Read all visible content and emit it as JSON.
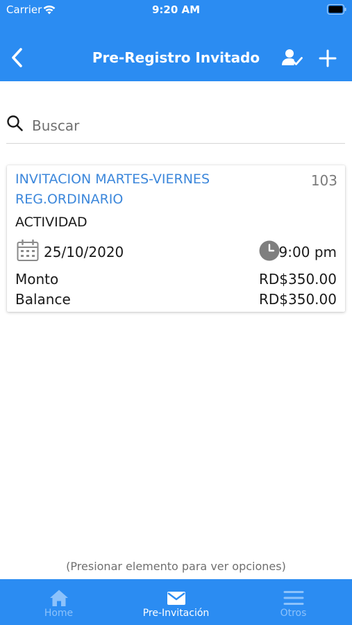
{
  "status_bar": {
    "carrier": "Carrier",
    "time": "9:20 AM"
  },
  "header": {
    "title": "Pre-Registro Invitado",
    "back_icon": "chevron-left-icon",
    "user_icon": "user-check-icon",
    "add_icon": "plus-icon",
    "background_color": "#2b8cf2"
  },
  "search": {
    "placeholder": "Buscar",
    "value": ""
  },
  "items": [
    {
      "title": "INVITACION MARTES-VIERNES REG.ORDINARIO",
      "number": "103",
      "type": "ACTIVIDAD",
      "date": "25/10/2020",
      "time": "9:00 pm",
      "amount_label": "Monto",
      "amount": "RD$350.00",
      "balance_label": "Balance",
      "balance": "RD$350.00"
    }
  ],
  "hint": "(Presionar elemento para ver opciones)",
  "tabbar": {
    "tabs": [
      {
        "label": "Home",
        "icon": "home-icon",
        "active": false
      },
      {
        "label": "Pre-Invitación",
        "icon": "mail-icon",
        "active": true
      },
      {
        "label": "Otros",
        "icon": "menu-icon",
        "active": false
      }
    ]
  },
  "colors": {
    "primary": "#2b8cf2",
    "link_text": "#3c87db",
    "inactive_tab": "#8cc2fb"
  }
}
